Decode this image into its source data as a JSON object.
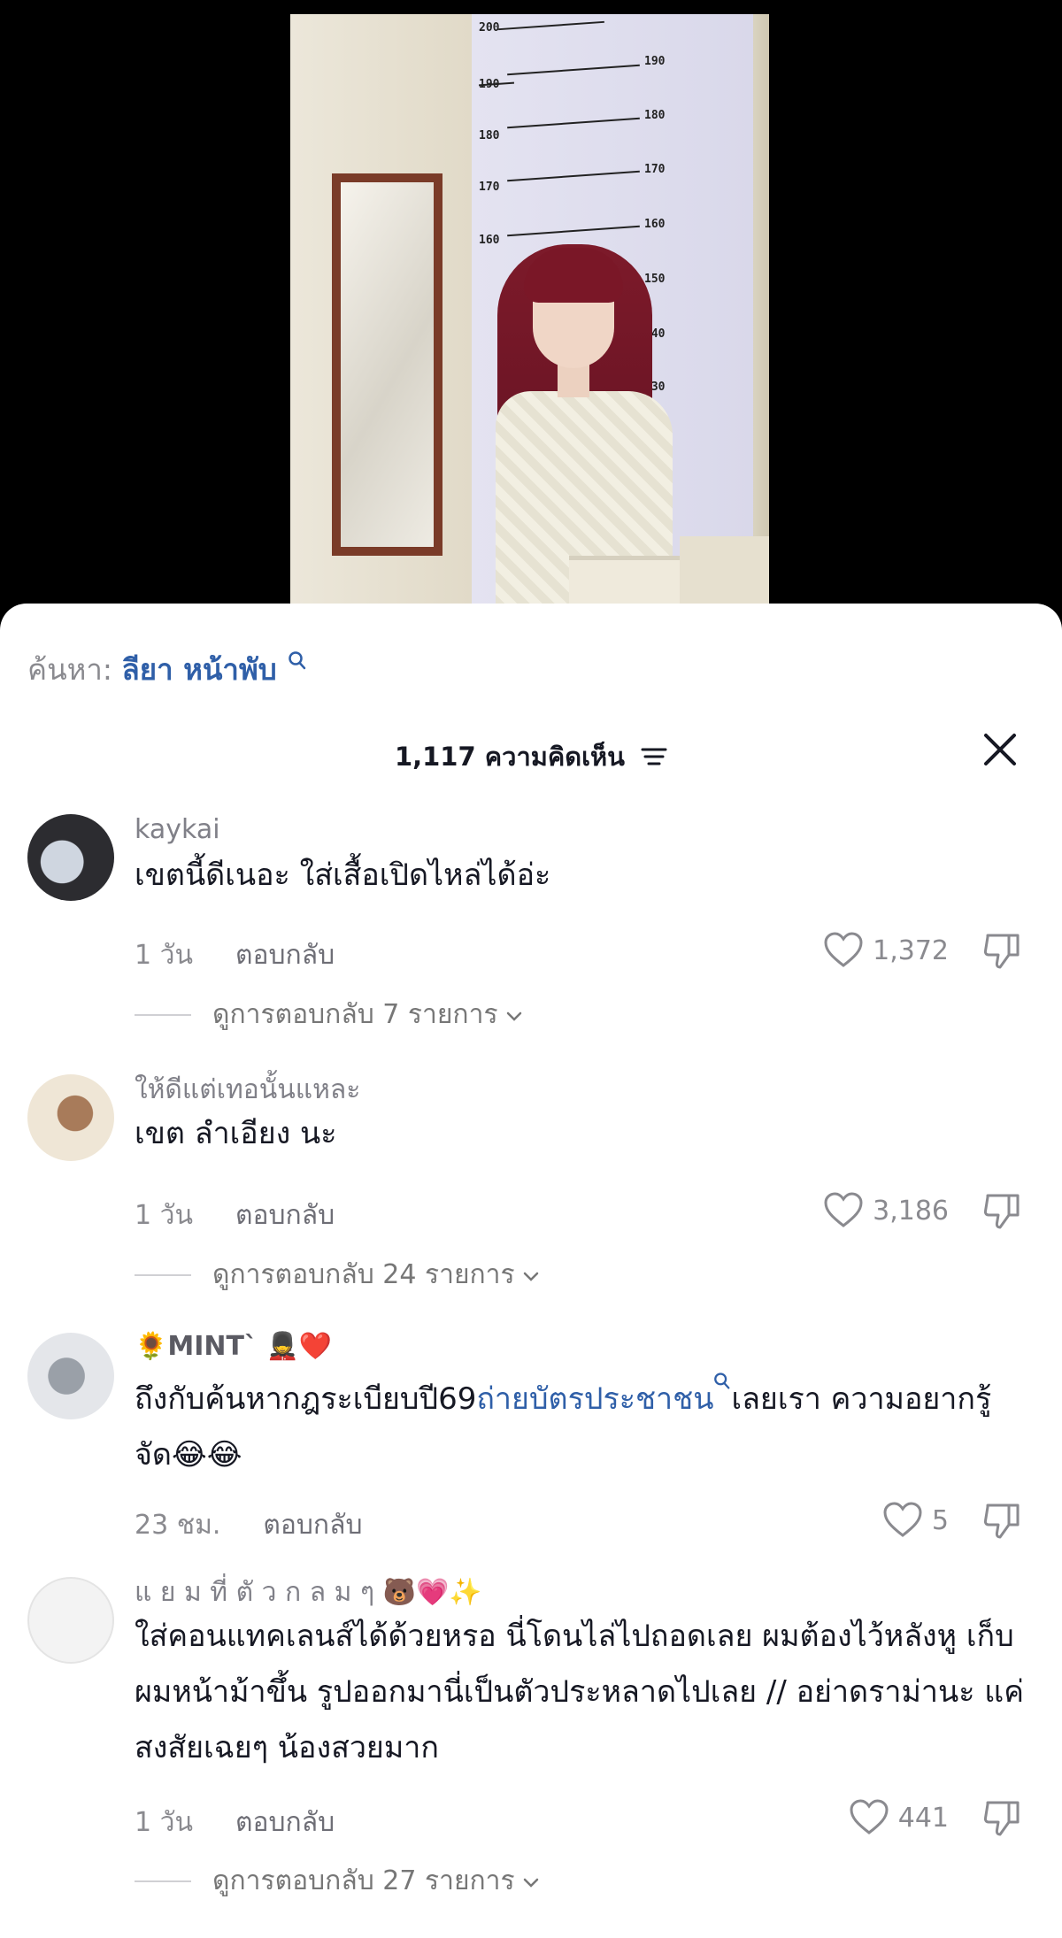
{
  "search": {
    "prefix": "ค้นหา:",
    "term": "ลียา หน้าพับ"
  },
  "header": {
    "count_label": "1,117 ความคิดเห็น"
  },
  "video": {
    "ruler_labels": [
      "200",
      "190",
      "190",
      "180",
      "180",
      "170",
      "170",
      "160",
      "160",
      "150",
      "140",
      "130"
    ]
  },
  "comments": [
    {
      "username": "kaykai",
      "text": "เขตนี้ดีเนอะ ใส่เสื้อเปิดไหล่ได้อ่ะ",
      "time": "1 วัน",
      "reply_label": "ตอบกลับ",
      "likes": "1,372",
      "view_replies": "ดูการตอบกลับ 7 รายการ"
    },
    {
      "username": "ให้ดีแต่เทอนั้นแหละ",
      "text": "เขต ลำเอียง นะ",
      "time": "1 วัน",
      "reply_label": "ตอบกลับ",
      "likes": "3,186",
      "view_replies": "ดูการตอบกลับ 24 รายการ"
    },
    {
      "username_prefix": "🌻",
      "username": "MINT`",
      "username_suffix": "💂❤️",
      "text_before": "ถึงกับค้นหากฎระเบียบปี69",
      "text_link": "ถ่ายบัตรประชาชน",
      "text_after": "เลยเรา ความอยากรู้จัด😂😂",
      "time": "23 ชม.",
      "reply_label": "ตอบกลับ",
      "likes": "5"
    },
    {
      "username": "แ ย ม ที่ ตั ว ก ล ม ๆ 🐻💗✨",
      "text": "ใส่คอนแทคเลนส์ได้ด้วยหรอ นี่โดนไล่ไปถอดเลย ผมต้องไว้หลังหู เก็บผมหน้าม้าขึ้น รูปออกมานี่เป็นตัวประหลาดไปเลย // อย่าดราม่านะ แค่สงสัยเฉยๆ น้องสวยมาก",
      "time": "1 วัน",
      "reply_label": "ตอบกลับ",
      "likes": "441",
      "view_replies": "ดูการตอบกลับ 27 รายการ"
    }
  ]
}
